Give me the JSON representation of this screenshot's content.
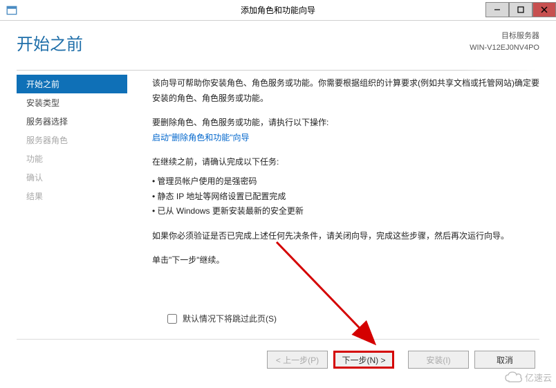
{
  "window": {
    "title": "添加角色和功能向导"
  },
  "header": {
    "page_title": "开始之前",
    "target_label": "目标服务器",
    "target_value": "WIN-V12EJ0NV4PO"
  },
  "sidebar": {
    "items": [
      {
        "label": "开始之前",
        "state": "active"
      },
      {
        "label": "安装类型",
        "state": "normal"
      },
      {
        "label": "服务器选择",
        "state": "normal"
      },
      {
        "label": "服务器角色",
        "state": "disabled"
      },
      {
        "label": "功能",
        "state": "disabled"
      },
      {
        "label": "确认",
        "state": "disabled"
      },
      {
        "label": "结果",
        "state": "disabled"
      }
    ]
  },
  "content": {
    "intro": "该向导可帮助你安装角色、角色服务或功能。你需要根据组织的计算要求(例如共享文档或托管网站)确定要安装的角色、角色服务或功能。",
    "remove_label": "要删除角色、角色服务或功能，请执行以下操作:",
    "remove_link": "启动\"删除角色和功能\"向导",
    "tasks_label": "在继续之前，请确认完成以下任务:",
    "tasks": [
      "管理员帐户使用的是强密码",
      "静态 IP 地址等网络设置已配置完成",
      "已从 Windows 更新安装最新的安全更新"
    ],
    "validation_note": "如果你必须验证是否已完成上述任何先决条件，请关闭向导，完成这些步骤，然后再次运行向导。",
    "continue_note": "单击\"下一步\"继续。",
    "skip_checkbox": "默认情况下将跳过此页(S)"
  },
  "buttons": {
    "previous": "< 上一步(P)",
    "next": "下一步(N) >",
    "install": "安装(I)",
    "cancel": "取消"
  },
  "watermark": {
    "text": "亿速云"
  }
}
